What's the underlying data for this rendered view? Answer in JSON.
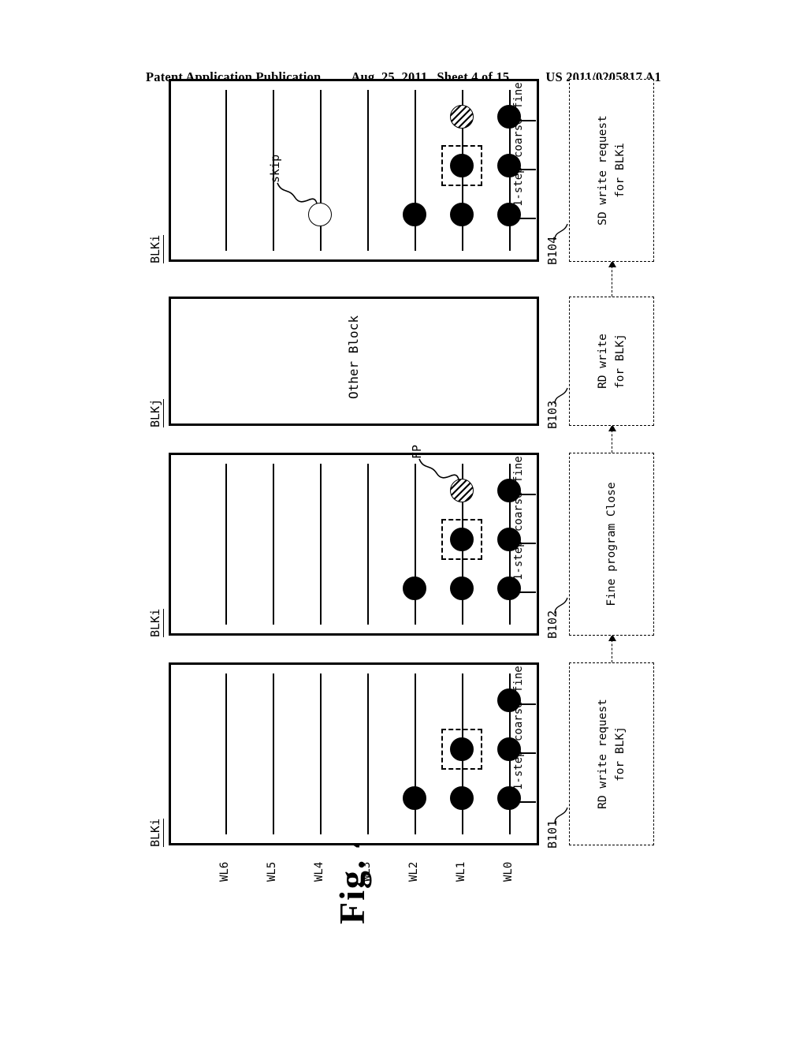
{
  "header": {
    "left": "Patent Application Publication",
    "date": "Aug. 25, 2011",
    "sheet": "Sheet 4 of 15",
    "number": "US 2011/0205817 A1"
  },
  "figure": {
    "title": "Fig. 4",
    "wordline_ticks": [
      "WL6",
      "WL5",
      "WL4",
      "WL3",
      "WL2",
      "WL1",
      "WL0"
    ],
    "stage_labels": [
      "1-step",
      "coarse",
      "fine"
    ],
    "panels": [
      {
        "id": "panel-1",
        "label": "BLKi",
        "dots": [
          {
            "wl": "WL2",
            "stage": "1-step",
            "style": "filled"
          },
          {
            "wl": "WL1",
            "stage": "1-step",
            "style": "filled"
          },
          {
            "wl": "WL1",
            "stage": "coarse",
            "style": "filled",
            "selected": true
          },
          {
            "wl": "WL0",
            "stage": "1-step",
            "style": "filled"
          },
          {
            "wl": "WL0",
            "stage": "coarse",
            "style": "filled"
          },
          {
            "wl": "WL0",
            "stage": "fine",
            "style": "filled"
          }
        ],
        "callouts": []
      },
      {
        "id": "panel-2",
        "label": "BLKi",
        "dots": [
          {
            "wl": "WL2",
            "stage": "1-step",
            "style": "filled"
          },
          {
            "wl": "WL1",
            "stage": "1-step",
            "style": "filled"
          },
          {
            "wl": "WL1",
            "stage": "coarse",
            "style": "filled",
            "selected": true
          },
          {
            "wl": "WL1",
            "stage": "fine",
            "style": "hatched"
          },
          {
            "wl": "WL0",
            "stage": "1-step",
            "style": "filled"
          },
          {
            "wl": "WL0",
            "stage": "coarse",
            "style": "filled"
          },
          {
            "wl": "WL0",
            "stage": "fine",
            "style": "filled"
          }
        ],
        "callouts": [
          {
            "text": "FP",
            "target_wl": "WL1",
            "target_stage": "fine"
          }
        ]
      },
      {
        "id": "panel-3",
        "label": "BLKj",
        "body_text": "Other Block",
        "dots": [],
        "callouts": []
      },
      {
        "id": "panel-4",
        "label": "BLKi",
        "dots": [
          {
            "wl": "WL4",
            "stage": "1-step",
            "style": "open"
          },
          {
            "wl": "WL2",
            "stage": "1-step",
            "style": "filled"
          },
          {
            "wl": "WL1",
            "stage": "1-step",
            "style": "filled"
          },
          {
            "wl": "WL1",
            "stage": "coarse",
            "style": "filled",
            "selected": true
          },
          {
            "wl": "WL1",
            "stage": "fine",
            "style": "hatched"
          },
          {
            "wl": "WL0",
            "stage": "1-step",
            "style": "filled"
          },
          {
            "wl": "WL0",
            "stage": "coarse",
            "style": "filled"
          },
          {
            "wl": "WL0",
            "stage": "fine",
            "style": "filled"
          }
        ],
        "callouts": [
          {
            "text": "skip",
            "target_wl": "WL4",
            "target_stage": "1-step"
          }
        ]
      }
    ],
    "flow": [
      {
        "ref": "B101",
        "lines": [
          "RD write request",
          "for BLKj"
        ]
      },
      {
        "ref": "B102",
        "lines": [
          "Fine program Close"
        ]
      },
      {
        "ref": "B103",
        "lines": [
          "RD write",
          "for BLKj"
        ]
      },
      {
        "ref": "B104",
        "lines": [
          "SD write request",
          "for BLKi"
        ]
      }
    ]
  }
}
